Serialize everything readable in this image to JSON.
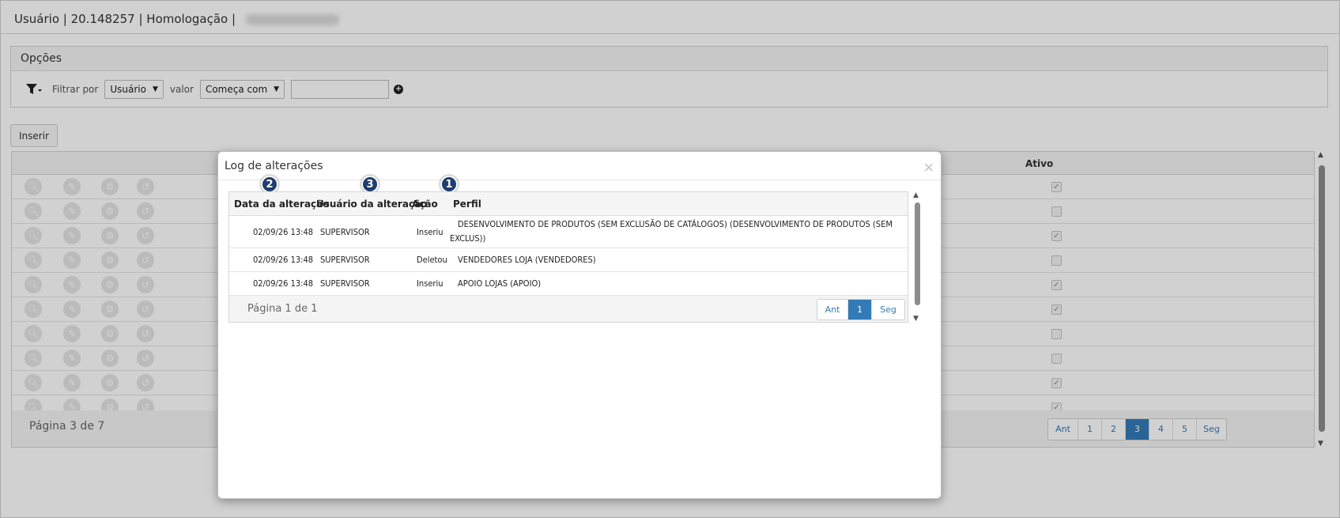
{
  "header": {
    "title": "Usuário | 20.148257 | Homologação |"
  },
  "options": {
    "title": "Opções",
    "filter_by_label": "Filtrar por",
    "filter_field": "Usuário",
    "value_label": "valor",
    "operator": "Começa com",
    "filter_text": ""
  },
  "toolbar": {
    "insert_label": "Inserir"
  },
  "grid": {
    "column_ativo": "Ativo",
    "rows": [
      {
        "ativo": true
      },
      {
        "ativo": false
      },
      {
        "ativo": true
      },
      {
        "ativo": false
      },
      {
        "ativo": true
      },
      {
        "ativo": true
      },
      {
        "ativo": false
      },
      {
        "ativo": false
      },
      {
        "ativo": true
      },
      {
        "ativo": true
      }
    ],
    "page_text": "Página 3 de 7",
    "pager": [
      "Ant",
      "1",
      "2",
      "3",
      "4",
      "5",
      "Seg"
    ],
    "active_page": "3"
  },
  "modal": {
    "title": "Log de alterações",
    "close": "×",
    "columns": {
      "date": "Data da alteração",
      "user": "Usuário da alteração",
      "action": "Ação",
      "profile": "Perfil"
    },
    "badges": {
      "date": "2",
      "user": "3",
      "action": "1"
    },
    "rows": [
      {
        "date": "02/09/26 13:48",
        "user": "SUPERVISOR",
        "action": "Inseriu",
        "profile_line1": "DESENVOLVIMENTO DE PRODUTOS (SEM EXCLUSÃO DE CATÁLOGOS) (DESENVOLVIMENTO DE PRODUTOS (SEM",
        "profile_line2": "EXCLUS))"
      },
      {
        "date": "02/09/26 13:48",
        "user": "SUPERVISOR",
        "action": "Deletou",
        "profile_line1": "VENDEDORES LOJA (VENDEDORES)",
        "profile_line2": ""
      },
      {
        "date": "02/09/26 13:48",
        "user": "SUPERVISOR",
        "action": "Inseriu",
        "profile_line1": "APOIO LOJAS (APOIO)",
        "profile_line2": ""
      }
    ],
    "page_text": "Página 1 de 1",
    "pager": [
      "Ant",
      "1",
      "Seg"
    ],
    "active_page": "1"
  },
  "icons": [
    "filter-icon",
    "plus-circle-icon",
    "search-icon",
    "edit-icon",
    "gear-icon",
    "history-icon",
    "close-icon"
  ],
  "colors": {
    "accent": "#337ab7",
    "badge": "#1f3d6e"
  }
}
